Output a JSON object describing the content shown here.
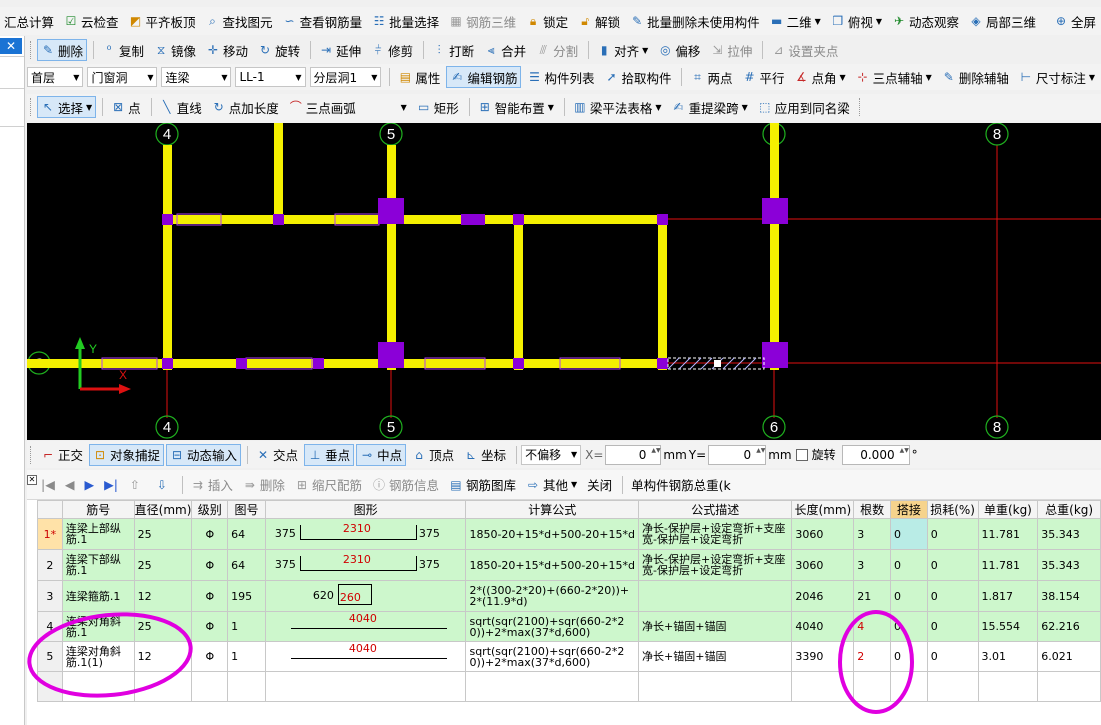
{
  "colors": {
    "yellow": "#f4f000",
    "purple": "#8b00d8",
    "red_axis": "#e01010",
    "annotation": "#e000e0",
    "canvas_bg": "#000000",
    "grid_green": "#cdf7cc"
  },
  "toolbar_main": [
    {
      "label": "汇总计算",
      "icon": "calc-icon"
    },
    {
      "label": "云检查",
      "icon": "cloud-check-icon"
    },
    {
      "label": "平齐板顶",
      "icon": "align-top-icon"
    },
    {
      "label": "查找图元",
      "icon": "binoculars-icon"
    },
    {
      "label": "查看钢筋量",
      "icon": "rebar-view-icon"
    },
    {
      "label": "批量选择",
      "icon": "batch-select-icon"
    },
    {
      "label": "钢筋三维",
      "icon": "rebar-3d-icon",
      "disabled": true
    },
    {
      "label": "锁定",
      "icon": "lock-icon"
    },
    {
      "label": "解锁",
      "icon": "unlock-icon"
    },
    {
      "label": "批量删除未使用构件",
      "icon": "batch-delete-icon"
    },
    {
      "label": "二维",
      "icon": "2d-icon",
      "dropdown": true
    },
    {
      "label": "俯视",
      "icon": "top-view-icon",
      "dropdown": true
    },
    {
      "label": "动态观察",
      "icon": "orbit-icon"
    },
    {
      "label": "局部三维",
      "icon": "local-3d-icon"
    },
    {
      "label": "全屏",
      "icon": "fullscreen-icon"
    }
  ],
  "toolbar_edit": [
    {
      "label": "删除",
      "icon": "delete-icon",
      "active": true
    },
    {
      "label": "复制",
      "icon": "copy-icon"
    },
    {
      "label": "镜像",
      "icon": "mirror-icon"
    },
    {
      "label": "移动",
      "icon": "move-icon"
    },
    {
      "label": "旋转",
      "icon": "rotate-icon"
    },
    {
      "label": "延伸",
      "icon": "extend-icon"
    },
    {
      "label": "修剪",
      "icon": "trim-icon"
    },
    {
      "label": "打断",
      "icon": "break-icon"
    },
    {
      "label": "合并",
      "icon": "merge-icon"
    },
    {
      "label": "分割",
      "icon": "split-icon",
      "disabled": true
    },
    {
      "label": "对齐",
      "icon": "align-icon",
      "dropdown": true
    },
    {
      "label": "偏移",
      "icon": "offset-icon"
    },
    {
      "label": "拉伸",
      "icon": "stretch-icon",
      "disabled": true
    },
    {
      "label": "设置夹点",
      "icon": "grip-point-icon",
      "disabled": true
    }
  ],
  "selectors": {
    "floor": "首层",
    "category": "门窗洞",
    "type": "连梁",
    "member": "LL-1",
    "layer": "分层洞1"
  },
  "toolbar_member": [
    {
      "label": "属性",
      "icon": "property-icon"
    },
    {
      "label": "编辑钢筋",
      "icon": "edit-rebar-icon",
      "active": true
    },
    {
      "label": "构件列表",
      "icon": "member-list-icon"
    },
    {
      "label": "拾取构件",
      "icon": "pick-icon"
    },
    {
      "label": "两点",
      "icon": "two-point-icon"
    },
    {
      "label": "平行",
      "icon": "parallel-icon"
    },
    {
      "label": "点角",
      "icon": "point-angle-icon",
      "dropdown": true
    },
    {
      "label": "三点辅轴",
      "icon": "three-point-axis-icon",
      "dropdown": true
    },
    {
      "label": "删除辅轴",
      "icon": "delete-axis-icon"
    },
    {
      "label": "尺寸标注",
      "icon": "dimension-icon",
      "dropdown": true
    }
  ],
  "toolbar_draw": [
    {
      "label": "选择",
      "icon": "cursor-icon",
      "active": true,
      "dropdown": true
    },
    {
      "label": "点",
      "icon": "point-icon"
    },
    {
      "label": "直线",
      "icon": "line-icon"
    },
    {
      "label": "点加长度",
      "icon": "point-length-icon"
    },
    {
      "label": "三点画弧",
      "icon": "arc-icon",
      "dropdown": true
    },
    {
      "label": "矩形",
      "icon": "rectangle-icon"
    },
    {
      "label": "智能布置",
      "icon": "smart-layout-icon",
      "dropdown": true
    },
    {
      "label": "梁平法表格",
      "icon": "beam-table-icon",
      "dropdown": true
    },
    {
      "label": "重提梁跨",
      "icon": "beam-span-icon",
      "dropdown": true
    },
    {
      "label": "应用到同名梁",
      "icon": "apply-same-icon"
    }
  ],
  "axes": {
    "top": [
      "4",
      "5",
      "6",
      "8"
    ],
    "bottom": [
      "4",
      "5",
      "6",
      "8"
    ],
    "left": "C",
    "y": "Y",
    "x": "X"
  },
  "snap": {
    "ortho": "正交",
    "object_snap": "对象捕捉",
    "dynamic_input": "动态输入",
    "intersection": "交点",
    "perpendicular": "垂点",
    "midpoint": "中点",
    "vertex": "顶点",
    "coordinate": "坐标",
    "offset_mode": "不偏移",
    "x_label": "X=",
    "x_value": "0",
    "y_label": "Y=",
    "y_value": "0",
    "unit": "mm",
    "rotate_label": "旋转",
    "rotate_value": "0.000",
    "degree": "°"
  },
  "grid_toolbar": [
    {
      "label": "插入",
      "icon": "insert-icon",
      "disabled": true
    },
    {
      "label": "删除",
      "icon": "delete-row-icon",
      "disabled": true
    },
    {
      "label": "缩尺配筋",
      "icon": "scale-rebar-icon",
      "disabled": true
    },
    {
      "label": "钢筋信息",
      "icon": "rebar-info-icon",
      "disabled": true
    },
    {
      "label": "钢筋图库",
      "icon": "rebar-library-icon"
    },
    {
      "label": "其他",
      "icon": "other-icon",
      "dropdown": true
    },
    {
      "label": "关闭",
      "icon": ""
    },
    {
      "label": "单构件钢筋总重(k",
      "icon": ""
    }
  ],
  "table": {
    "headers": [
      "筋号",
      "直径(mm)",
      "级别",
      "图号",
      "图形",
      "计算公式",
      "公式描述",
      "长度(mm)",
      "根数",
      "搭接",
      "损耗(%)",
      "单重(kg)",
      "总重(kg)"
    ],
    "rows": [
      {
        "row_no": "1*",
        "name": "连梁上部纵筋.1",
        "diameter": "25",
        "grade": "Φ",
        "fig_no": "64",
        "shape": {
          "left": "375",
          "mid": "2310",
          "right": "375"
        },
        "formula": "1850-20+15*d+500-20+15*d",
        "desc": "净长-保护层+设定弯折+支座宽-保护层+设定弯折",
        "length": "3060",
        "count": "3",
        "lap": "0",
        "loss": "0",
        "unit_wt": "11.781",
        "total_wt": "35.343"
      },
      {
        "row_no": "2",
        "name": "连梁下部纵筋.1",
        "diameter": "25",
        "grade": "Φ",
        "fig_no": "64",
        "shape": {
          "left": "375",
          "mid": "2310",
          "right": "375"
        },
        "formula": "1850-20+15*d+500-20+15*d",
        "desc": "净长-保护层+设定弯折+支座宽-保护层+设定弯折",
        "length": "3060",
        "count": "3",
        "lap": "0",
        "loss": "0",
        "unit_wt": "11.781",
        "total_wt": "35.343"
      },
      {
        "row_no": "3",
        "name": "连梁箍筋.1",
        "diameter": "12",
        "grade": "Φ",
        "fig_no": "195",
        "shape": {
          "left": "620",
          "mid": "260"
        },
        "formula": "2*((300-2*20)+(660-2*20))+2*(11.9*d)",
        "desc": "",
        "length": "2046",
        "count": "21",
        "lap": "0",
        "loss": "0",
        "unit_wt": "1.817",
        "total_wt": "38.154"
      },
      {
        "row_no": "4",
        "name": "连梁对角斜筋.1",
        "diameter": "25",
        "grade": "Φ",
        "fig_no": "1",
        "shape": {
          "mid": "4040"
        },
        "formula": "sqrt(sqr(2100)+sqr(660-2*20))+2*max(37*d,600)",
        "desc": "净长+锚固+锚固",
        "length": "4040",
        "count": "4",
        "lap": "0",
        "loss": "0",
        "unit_wt": "15.554",
        "total_wt": "62.216"
      },
      {
        "row_no": "5",
        "name": "连梁对角斜筋.1(1)",
        "diameter": "12",
        "grade": "Φ",
        "fig_no": "1",
        "shape": {
          "mid": "4040"
        },
        "formula": "sqrt(sqr(2100)+sqr(660-2*20))+2*max(37*d,600)",
        "desc": "净长+锚固+锚固",
        "length": "3390",
        "count": "2",
        "lap": "0",
        "loss": "0",
        "unit_wt": "3.01",
        "total_wt": "6.021"
      }
    ]
  }
}
